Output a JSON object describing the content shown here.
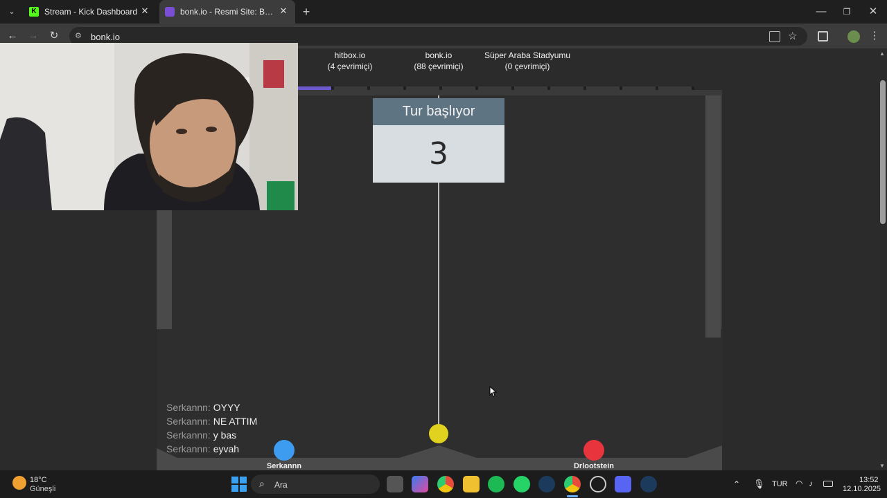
{
  "browser": {
    "tabs": [
      {
        "title": "Stream - Kick Dashboard",
        "close": "✕"
      },
      {
        "title": "bonk.io - Resmi Site: Burada Bo",
        "close": "✕"
      }
    ],
    "new_tab": "+",
    "url": "bonk.io",
    "window_controls": {
      "minimize": "—",
      "restore": "❐",
      "close": "✕"
    },
    "nav": {
      "back": "←",
      "forward": "→",
      "reload": "↻",
      "menu": "⋮"
    }
  },
  "game": {
    "servers": [
      {
        "name": "hitbox.io",
        "status": "(4 çevrimiçi)"
      },
      {
        "name": "bonk.io",
        "status": "(88 çevrimiçi)"
      },
      {
        "name": "Süper Araba Stadyumu",
        "status": "(0 çevrimiçi)"
      }
    ],
    "countdown": {
      "title": "Tur başlıyor",
      "value": "3"
    },
    "chat": [
      {
        "user": "Serkannn:",
        "message": "OYYY"
      },
      {
        "user": "Serkannn:",
        "message": "NE ATTIM"
      },
      {
        "user": "Serkannn:",
        "message": "y bas"
      },
      {
        "user": "Serkannn:",
        "message": "eyvah"
      }
    ],
    "players": [
      {
        "name": "Serkannn",
        "color": "#3d9cf0"
      },
      {
        "name": "Drlootstein",
        "color": "#e8343c"
      }
    ],
    "ball_color": "#e0d21e"
  },
  "taskbar": {
    "weather_temp": "18°C",
    "weather_desc": "Güneşli",
    "search_placeholder": "Ara",
    "language": "TUR",
    "time": "13:52",
    "date": "12.10.2025"
  }
}
